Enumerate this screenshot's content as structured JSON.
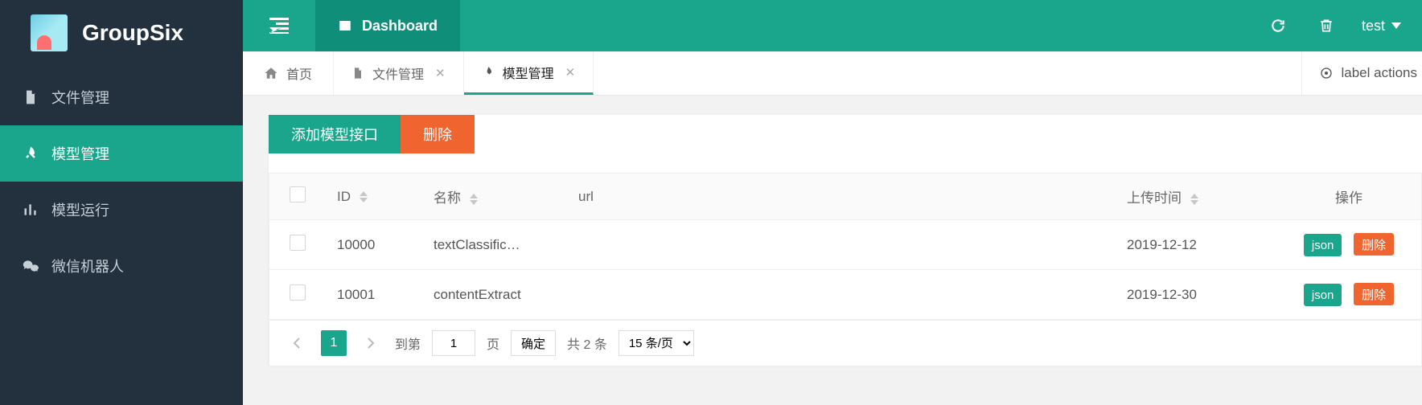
{
  "brand": {
    "name": "GroupSix"
  },
  "sidebar": {
    "items": [
      {
        "label": "文件管理",
        "icon": "file-icon"
      },
      {
        "label": "模型管理",
        "icon": "rocket-icon",
        "active": true
      },
      {
        "label": "模型运行",
        "icon": "bar-chart-icon"
      },
      {
        "label": "微信机器人",
        "icon": "wechat-icon"
      }
    ]
  },
  "topbar": {
    "dashboard_label": "Dashboard",
    "username": "test"
  },
  "tabs": [
    {
      "label": "首页",
      "icon": "home-icon",
      "closable": false
    },
    {
      "label": "文件管理",
      "icon": "file-icon",
      "closable": true
    },
    {
      "label": "模型管理",
      "icon": "rocket-icon",
      "closable": true,
      "active": true
    }
  ],
  "tabstrip": {
    "label_actions": "label actions"
  },
  "toolbar": {
    "add_label": "添加模型接口",
    "delete_label": "删除"
  },
  "table": {
    "headers": {
      "id": "ID",
      "name": "名称",
      "url": "url",
      "time": "上传时间",
      "ops": "操作"
    },
    "ops": {
      "json": "json",
      "delete": "删除"
    },
    "rows": [
      {
        "id": "10000",
        "name": "textClassific…",
        "url": "",
        "time": "2019-12-12"
      },
      {
        "id": "10001",
        "name": "contentExtract",
        "url": "",
        "time": "2019-12-30"
      }
    ]
  },
  "pager": {
    "current_page": "1",
    "goto_label": "到第",
    "page_input_value": "1",
    "page_unit": "页",
    "go_label": "确定",
    "total_text": "共 2 条",
    "page_size_label": "15 条/页"
  }
}
